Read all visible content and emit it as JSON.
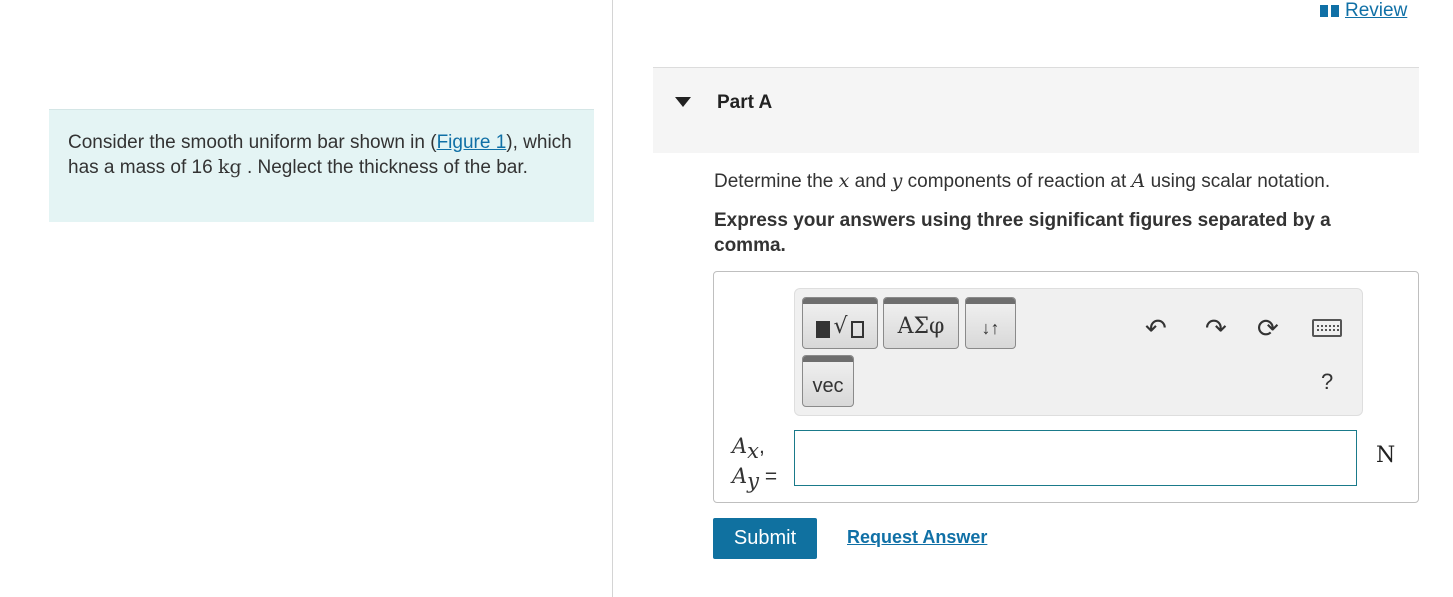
{
  "header": {
    "review_label": "Review"
  },
  "problem": {
    "text_before": "Consider the smooth uniform bar shown in (",
    "figure_link": "Figure 1",
    "text_mid": "), which has a mass of 16",
    "unit": "kg",
    "text_after": ". Neglect the thickness of the bar."
  },
  "part": {
    "title": "Part A",
    "question_a": "Determine the",
    "var_x": "x",
    "question_b": "and",
    "var_y": "y",
    "question_c": "components of reaction at",
    "var_A": "A",
    "question_d": "using scalar notation.",
    "instruction": "Express your answers using three significant figures separated by a comma."
  },
  "toolbar": {
    "greek_label": "ΑΣφ",
    "arrows_label": "↓↑",
    "vec_label": "vec",
    "undo_icon": "undo-icon",
    "redo_icon": "redo-icon",
    "reset_icon": "reset-icon",
    "keyboard_icon": "keyboard-icon",
    "help_label": "?"
  },
  "answer": {
    "label_line1": "A",
    "sub_1": "x",
    "comma": ",",
    "label_line2": "A",
    "sub_2": "y",
    "equals": " =",
    "value": "",
    "unit": "N"
  },
  "actions": {
    "submit_label": "Submit",
    "request_label": "Request Answer"
  },
  "colors": {
    "accent": "#1070a6",
    "problem_bg": "#e4f4f4",
    "submit_bg": "#1071a0"
  }
}
